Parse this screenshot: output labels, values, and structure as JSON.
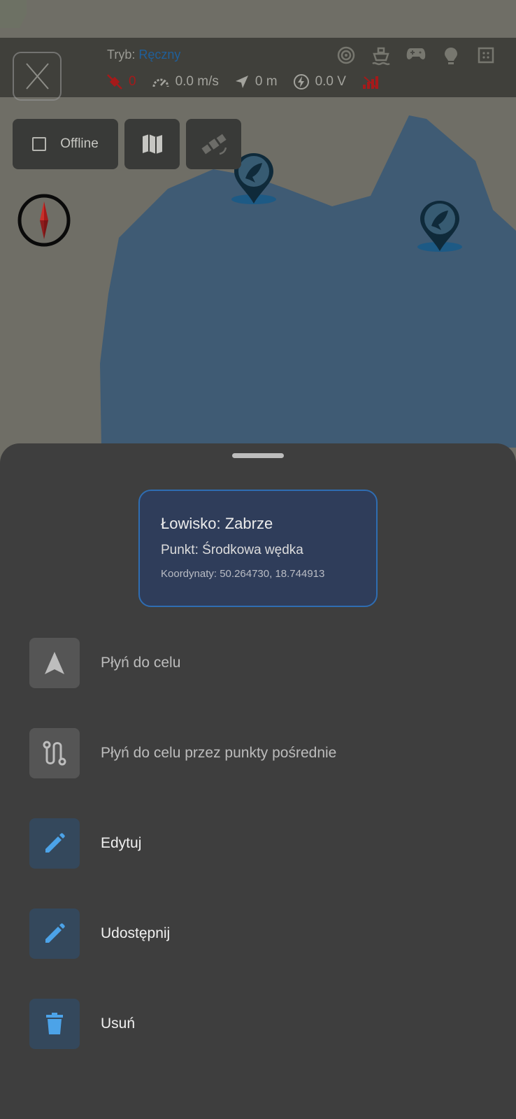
{
  "status": {
    "mode_label": "Tryb:",
    "mode_value": "Ręczny",
    "satellites": "0",
    "speed": "0.0 m/s",
    "distance": "0 m",
    "voltage": "0.0 V"
  },
  "map_controls": {
    "offline_label": "Offline"
  },
  "card": {
    "title": "Łowisko: Zabrze",
    "point": "Punkt: Środkowa wędka",
    "coords": "Koordynaty: 50.264730, 18.744913"
  },
  "actions": [
    {
      "label": "Płyń do celu",
      "icon": "navigation-arrow-icon"
    },
    {
      "label": "Płyń do celu przez punkty pośrednie",
      "icon": "route-icon"
    },
    {
      "label": "Edytuj",
      "icon": "pencil-icon"
    },
    {
      "label": "Udostępnij",
      "icon": "pencil-icon"
    },
    {
      "label": "Usuń",
      "icon": "trash-icon"
    }
  ],
  "colors": {
    "water": "#3f5b74",
    "land": "#6f6e66",
    "sheet": "#3e3e3e",
    "accent": "#4ca3e8",
    "alert": "#a51a1a"
  }
}
